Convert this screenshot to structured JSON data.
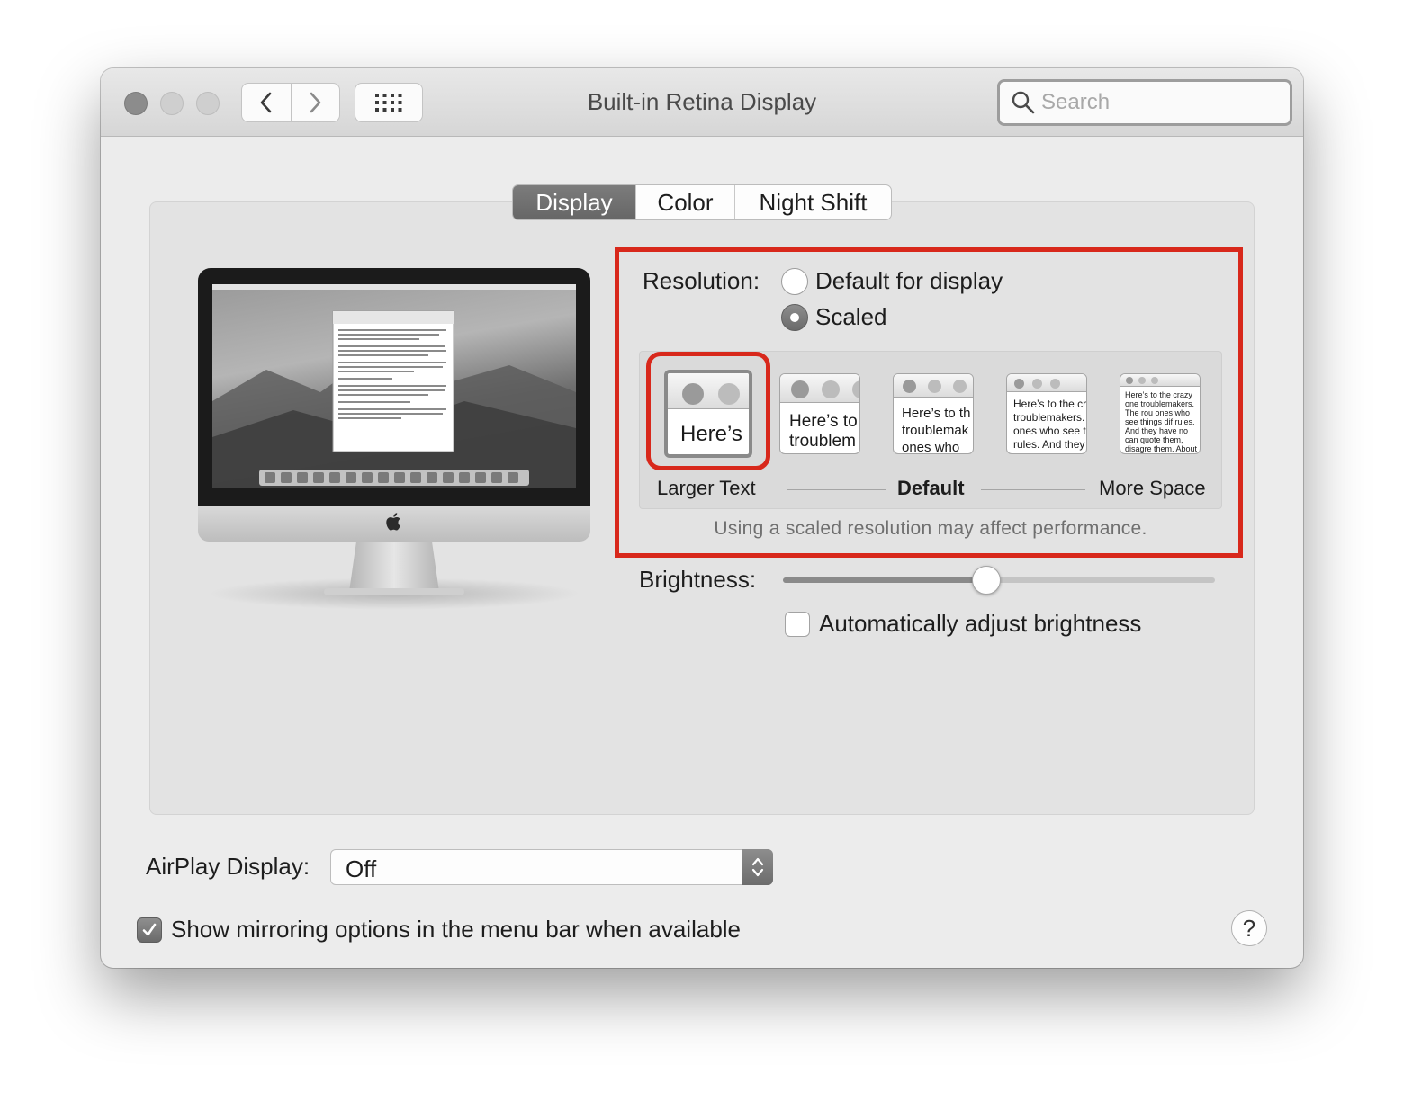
{
  "window": {
    "title": "Built-in Retina Display"
  },
  "search": {
    "placeholder": "Search"
  },
  "tabs": [
    {
      "label": "Display",
      "selected": true
    },
    {
      "label": "Color",
      "selected": false
    },
    {
      "label": "Night Shift",
      "selected": false
    }
  ],
  "resolution": {
    "label": "Resolution:",
    "options": [
      {
        "label": "Default for display",
        "selected": false
      },
      {
        "label": "Scaled",
        "selected": true
      }
    ],
    "scaled_options": [
      {
        "preview_text": "Here’s",
        "selected": true
      },
      {
        "preview_text": "Here’s to troublem",
        "selected": false
      },
      {
        "preview_text": "Here’s to th troublemak ones who",
        "selected": false
      },
      {
        "preview_text": "Here’s to the cr troublemakers. ones who see t rules. And they",
        "selected": false
      },
      {
        "preview_text": "Here’s to the crazy one troublemakers. The rou ones who see things dif rules. And they have no can quote them, disagre them. About the only th Because they change t",
        "selected": false
      }
    ],
    "scale_labels": {
      "left": "Larger Text",
      "middle": "Default",
      "right": "More Space"
    },
    "note": "Using a scaled resolution may affect performance."
  },
  "brightness": {
    "label": "Brightness:",
    "value": 0.47,
    "auto_label": "Automatically adjust brightness",
    "auto_checked": false
  },
  "airplay": {
    "label": "AirPlay Display:",
    "value": "Off"
  },
  "mirroring": {
    "label": "Show mirroring options in the menu bar when available",
    "checked": true
  },
  "help": {
    "label": "?"
  },
  "colors": {
    "highlight": "#d8281b",
    "selected_control": "#6f6f6f"
  }
}
